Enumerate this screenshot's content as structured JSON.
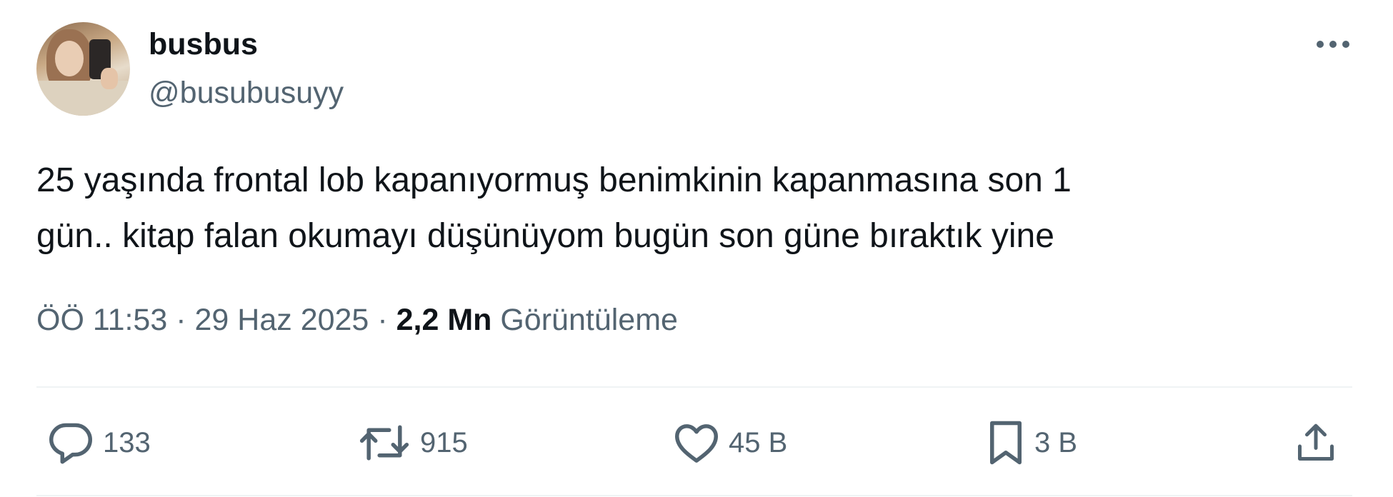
{
  "author": {
    "display_name": "busbus",
    "handle": "@busubusuyy"
  },
  "tweet": {
    "text_line1": "25 yaşında frontal lob kapanıyormuş benimkinin kapanmasına son 1",
    "text_line2": "gün.. kitap falan okumayı düşünüyom bugün son güne bıraktık yine"
  },
  "meta": {
    "time": "ÖÖ 11:53",
    "separator1": "·",
    "date": "29 Haz 2025",
    "separator2": "·",
    "views_count": "2,2 Mn",
    "views_label": "Görüntüleme"
  },
  "actions": {
    "reply_count": "133",
    "retweet_count": "915",
    "like_count": "45 B",
    "bookmark_count": "3 B"
  },
  "icons": {
    "more": "more-horizontal-icon",
    "reply": "reply-icon",
    "retweet": "retweet-icon",
    "like": "heart-icon",
    "bookmark": "bookmark-icon",
    "share": "share-icon"
  },
  "colors": {
    "text_primary": "#0f1419",
    "text_secondary": "#536471",
    "divider": "#eff3f4"
  }
}
